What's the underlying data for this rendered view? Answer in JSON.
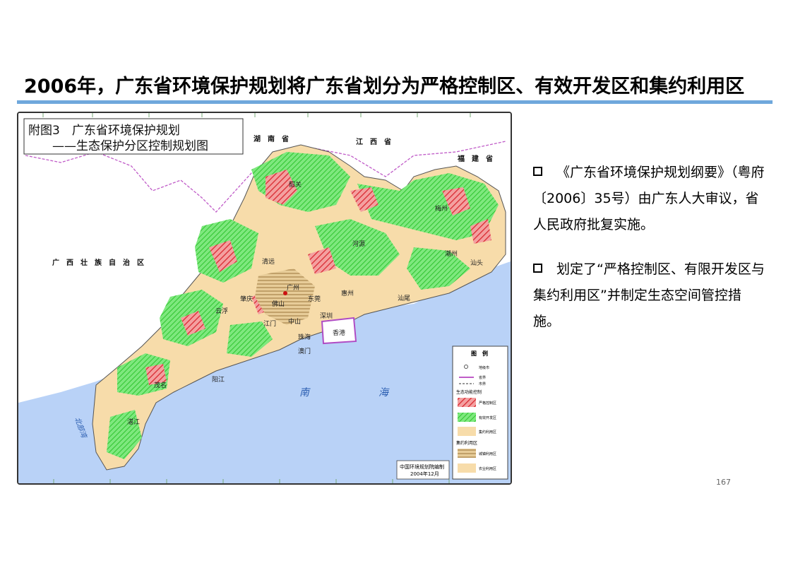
{
  "slide": {
    "title": "2006年，广东省环境保护规划将广东省划分为严格控制区、有效开发区和集约利用区",
    "page_number": "167"
  },
  "map": {
    "heading_line1": "附图3　广东省环境保护规划",
    "heading_line2": "——生态保护分区控制规划图",
    "neighbors": [
      "湖　南　省",
      "江　西　省",
      "福　建　省",
      "广　西　壮　族　自　治　区"
    ],
    "cities": [
      "韶关",
      "梅州",
      "河源",
      "潮州",
      "汕头",
      "清远",
      "广州",
      "惠州",
      "汕尾",
      "肇庆",
      "佛山",
      "东莞",
      "深圳",
      "云浮",
      "江门",
      "中山",
      "珠海",
      "香港",
      "澳门",
      "阳江",
      "茂名",
      "湛江"
    ],
    "sea_labels": [
      "南",
      "海",
      "北部湾"
    ],
    "credit_line1": "中国环境规划院编制",
    "credit_line2": "2004年12月",
    "colors": {
      "strict": "#e8414b",
      "effective": "#55dd55",
      "intensive": "#f7dcaa",
      "sea": "#b9d2f7",
      "hk_border": "#b04cc4"
    },
    "legend": {
      "title": "图　例",
      "items": [
        "地级市",
        "省界",
        "市界",
        "生态功能控制",
        "严格控制区",
        "有效开发区",
        "集约利用区",
        "集约利用区",
        "城镇利用区",
        "农业利用区"
      ]
    }
  },
  "bullets": [
    "《广东省环境保护规划纲要》（粤府〔2006〕35号）由广东人大审议，省人民政府批复实施。",
    "划定了“严格控制区、有限开发区与集约利用区”并制定生态空间管控措施。"
  ]
}
